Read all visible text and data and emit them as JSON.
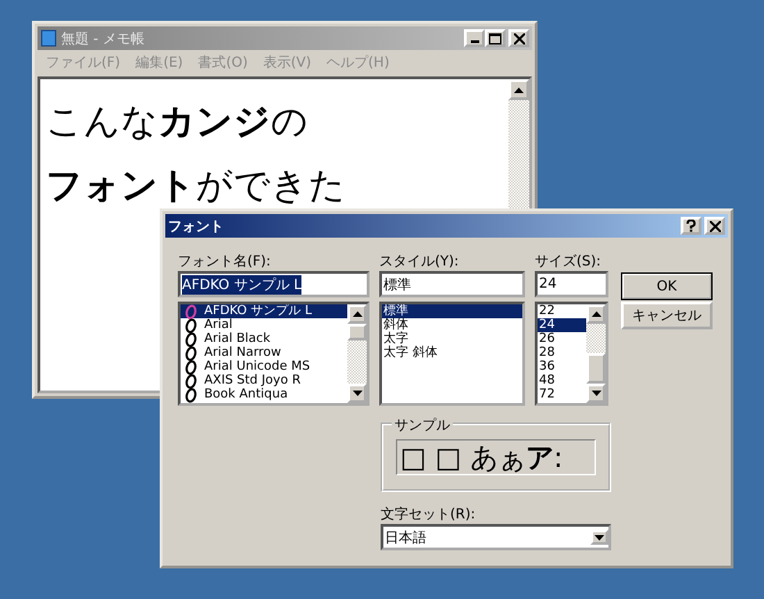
{
  "notepad": {
    "title": "無題 - メモ帳",
    "menu": [
      "ファイル(F)",
      "編集(E)",
      "書式(O)",
      "表示(V)",
      "ヘルプ(H)"
    ],
    "lines": [
      "こんな**カンジ**の",
      "**フォント**ができた"
    ]
  },
  "dialog": {
    "title": "フォント",
    "font_name": {
      "label": "フォント名(F):",
      "value": "AFDKO サンプル L",
      "items": [
        {
          "label": "AFDKO サンプル L",
          "selected": true
        },
        {
          "label": "Arial",
          "selected": false
        },
        {
          "label": "Arial Black",
          "selected": false
        },
        {
          "label": "Arial Narrow",
          "selected": false
        },
        {
          "label": "Arial Unicode MS",
          "selected": false
        },
        {
          "label": "AXIS Std Joyo R",
          "selected": false
        },
        {
          "label": "Book Antiqua",
          "selected": false
        }
      ]
    },
    "style": {
      "label": "スタイル(Y):",
      "value": "標準",
      "items": [
        {
          "label": "標準",
          "selected": true
        },
        {
          "label": "斜体",
          "selected": false
        },
        {
          "label": "太字",
          "selected": false
        },
        {
          "label": "太字 斜体",
          "selected": false
        }
      ]
    },
    "size": {
      "label": "サイズ(S):",
      "value": "24",
      "items": [
        {
          "label": "22",
          "selected": false
        },
        {
          "label": "24",
          "selected": true
        },
        {
          "label": "26",
          "selected": false
        },
        {
          "label": "28",
          "selected": false
        },
        {
          "label": "36",
          "selected": false
        },
        {
          "label": "48",
          "selected": false
        },
        {
          "label": "72",
          "selected": false
        }
      ]
    },
    "buttons": [
      "OK",
      "キャンセル"
    ],
    "sample": {
      "label": "サンプル",
      "text": "□ □ あぁ**ア**:"
    },
    "charset": {
      "label": "文字セット(R):",
      "value": "日本語"
    }
  }
}
